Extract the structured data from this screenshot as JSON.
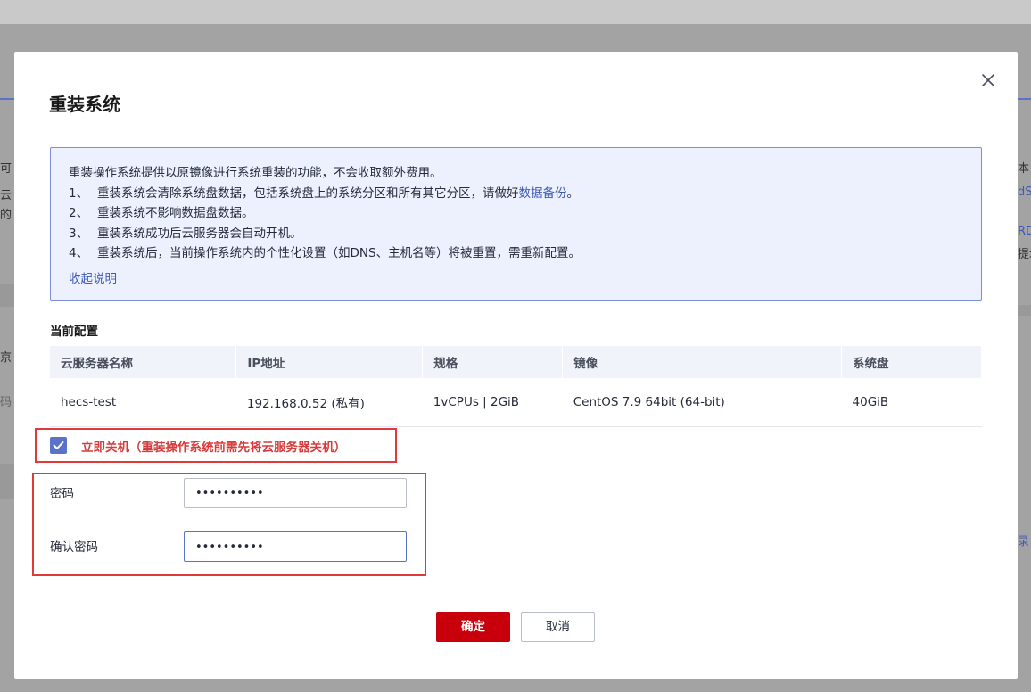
{
  "background": {
    "left_fragments": [
      "可",
      "云",
      "的",
      "京",
      "码"
    ],
    "right_fragments": [
      "本",
      "dS",
      "RD",
      "提示",
      "录"
    ]
  },
  "dialog": {
    "title": "重装系统",
    "info": {
      "intro": "重装操作系统提供以原镜像进行系统重装的功能，不会收取额外费用。",
      "items": [
        {
          "num": "1、",
          "text": "重装系统会清除系统盘数据，包括系统盘上的系统分区和所有其它分区，请做好",
          "link": "数据备份",
          "suffix": "。"
        },
        {
          "num": "2、",
          "text": "重装系统不影响数据盘数据。",
          "link": "",
          "suffix": ""
        },
        {
          "num": "3、",
          "text": "重装系统成功后云服务器会自动开机。",
          "link": "",
          "suffix": ""
        },
        {
          "num": "4、",
          "text": "重装系统后，当前操作系统内的个性化设置（如DNS、主机名等）将被重置，需重新配置。",
          "link": "",
          "suffix": ""
        }
      ],
      "collapse": "收起说明"
    },
    "current_config": {
      "title": "当前配置",
      "headers": [
        "云服务器名称",
        "IP地址",
        "规格",
        "镜像",
        "系统盘"
      ],
      "row": [
        "hecs-test",
        "192.168.0.52 (私有)",
        "1vCPUs | 2GiB",
        "CentOS 7.9 64bit (64-bit)",
        "40GiB"
      ]
    },
    "shutdown": {
      "checked": true,
      "label": "立即关机（重装操作系统前需先将云服务器关机）"
    },
    "password": {
      "label": "密码",
      "value": "••••••••••"
    },
    "confirm_password": {
      "label": "确认密码",
      "value": "••••••••••"
    },
    "buttons": {
      "ok": "确定",
      "cancel": "取消"
    }
  },
  "colors": {
    "primary_red": "#c7000b",
    "accent_blue": "#5a73c9",
    "highlight_red": "#e0393a"
  }
}
